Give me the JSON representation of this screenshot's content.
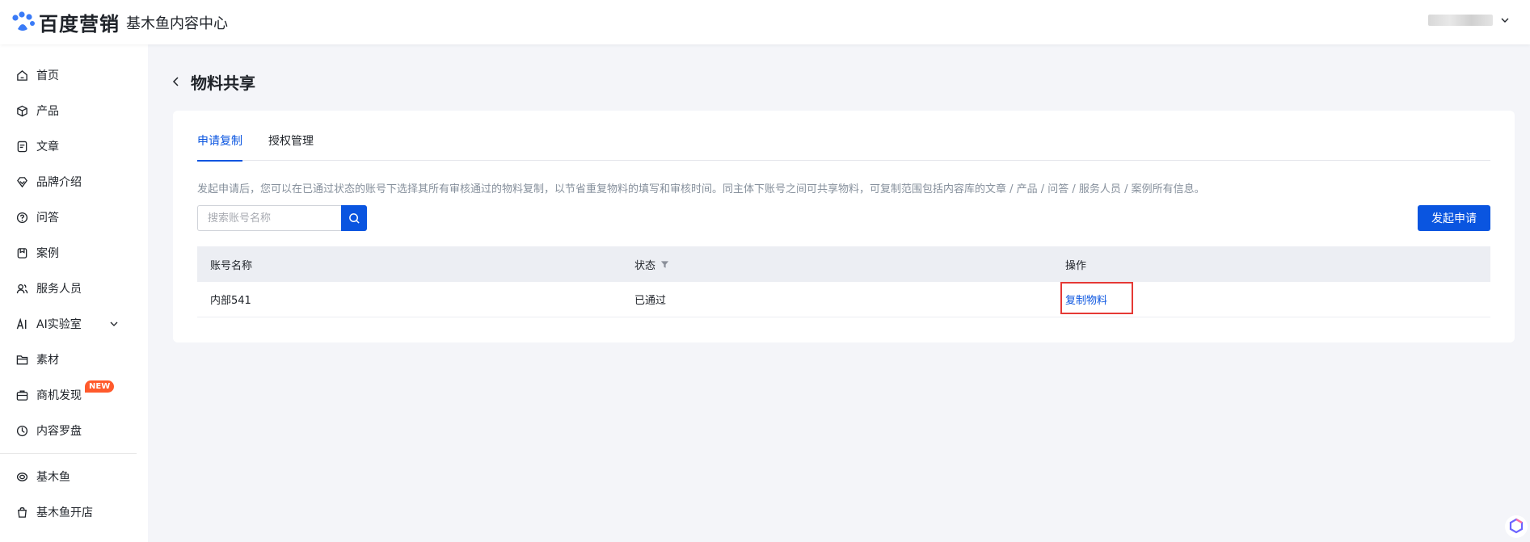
{
  "header": {
    "brand_name": "百度营销",
    "product_name": "基木鱼内容中心"
  },
  "sidebar": {
    "items": [
      {
        "label": "首页"
      },
      {
        "label": "产品"
      },
      {
        "label": "文章"
      },
      {
        "label": "品牌介绍"
      },
      {
        "label": "问答"
      },
      {
        "label": "案例"
      },
      {
        "label": "服务人员"
      },
      {
        "label": "AI实验室"
      },
      {
        "label": "素材"
      },
      {
        "label": "商机发现",
        "badge": "NEW"
      },
      {
        "label": "内容罗盘"
      }
    ],
    "bottom_items": [
      {
        "label": "基木鱼"
      },
      {
        "label": "基木鱼开店"
      }
    ]
  },
  "page": {
    "title": "物料共享"
  },
  "tabs": [
    {
      "label": "申请复制",
      "active": true
    },
    {
      "label": "授权管理",
      "active": false
    }
  ],
  "description": "发起申请后，您可以在已通过状态的账号下选择其所有审核通过的物料复制，以节省重复物料的填写和审核时间。同主体下账号之间可共享物料，可复制范围包括内容库的文章 / 产品 / 问答 / 服务人员 / 案例所有信息。",
  "search": {
    "placeholder": "搜索账号名称",
    "value": ""
  },
  "actions": {
    "primary": "发起申请"
  },
  "table": {
    "columns": [
      "账号名称",
      "状态",
      "操作"
    ],
    "rows": [
      {
        "account": "内部541",
        "status": "已通过",
        "action": "复制物料"
      }
    ]
  },
  "colors": {
    "accent": "#0a55e0",
    "badge": "#ff5a2c",
    "highlight": "#e53935"
  }
}
